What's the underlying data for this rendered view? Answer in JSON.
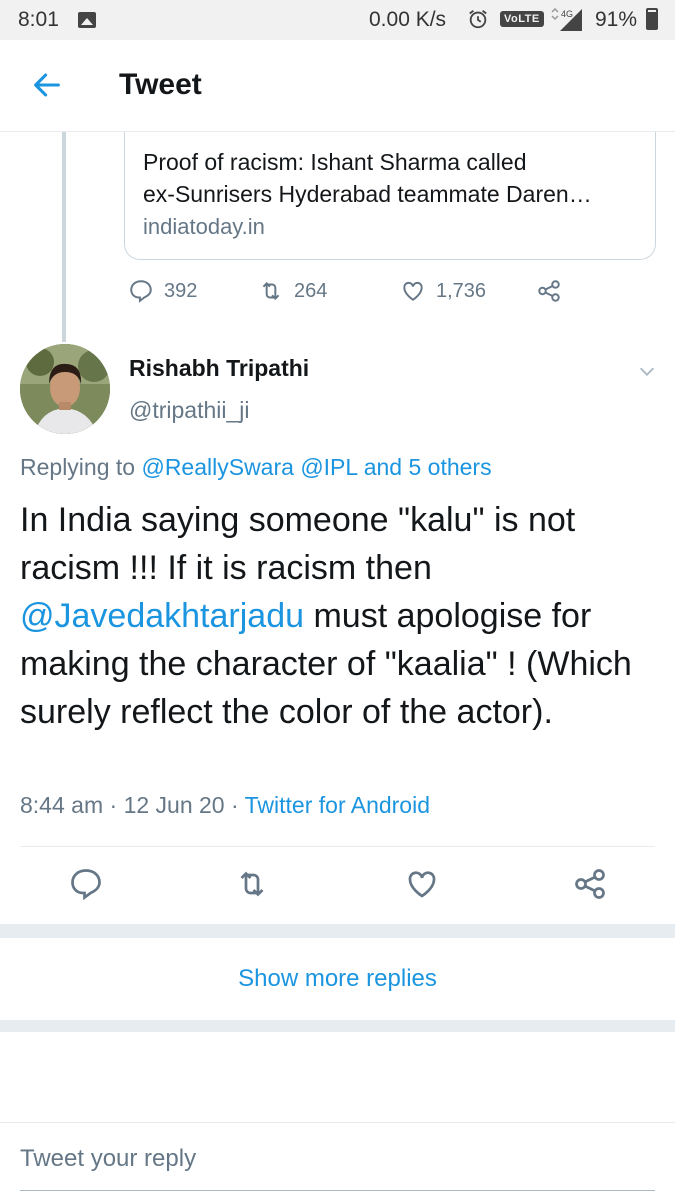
{
  "status_bar": {
    "time": "8:01",
    "network_speed": "0.00 K/s",
    "volte": "VoLTE",
    "network_type": "4G",
    "battery": "91%"
  },
  "header": {
    "title": "Tweet"
  },
  "quoted_link": {
    "title_line1": "Proof of racism: Ishant Sharma called",
    "title_line2": "ex-Sunrisers Hyderabad teammate Daren…",
    "domain": "indiatoday.in"
  },
  "previous_tweet_stats": {
    "replies": "392",
    "retweets": "264",
    "likes": "1,736"
  },
  "tweet": {
    "author_name": "Rishabh Tripathi",
    "author_handle": "@tripathii_ji",
    "replying_prefix": "Replying to",
    "replying_to": "@ReallySwara @IPL and 5 others",
    "text_part1": "In India saying someone \"kalu\" is not racism !!! If it is racism then ",
    "mention": "@Javedakhtarjadu",
    "text_part2": " must apologise for making the character of \"kaalia\" ! (Which surely reflect the color of the actor).",
    "time": "8:44 am",
    "date": "12 Jun 20",
    "client": "Twitter for Android",
    "meta_separator": "·"
  },
  "show_more_replies": "Show more replies",
  "reply": {
    "placeholder": "Tweet your reply"
  },
  "colors": {
    "accent": "#1b95e0",
    "secondary_text": "#657786",
    "divider": "#e6ecf0"
  }
}
